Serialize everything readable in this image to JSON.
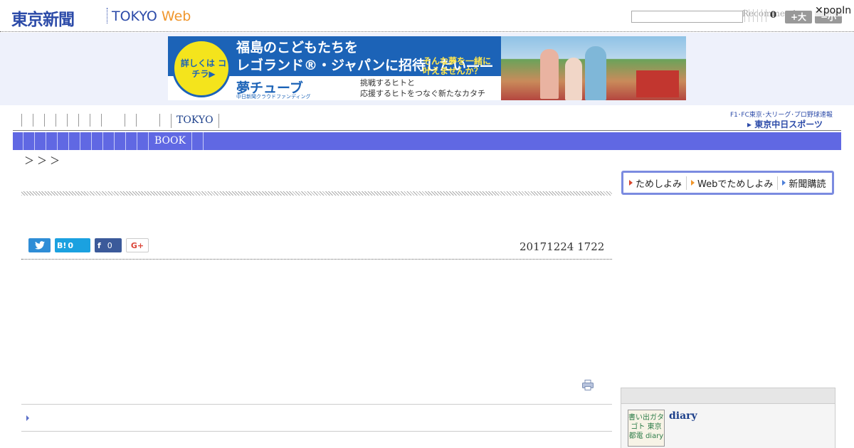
{
  "header": {
    "logo_jp": "東京新聞",
    "logo_tokyo": "TOKYO",
    "logo_web": "Web",
    "search_placeholder": "",
    "recommend": "Recommend",
    "count": "0",
    "font_big": "+大",
    "font_small": "−小",
    "popin": "✕popIn"
  },
  "ad": {
    "circle_text": "詳しくは コチラ▶",
    "headline_1": "福島のこどもたちを",
    "headline_2": "レゴランド®・ジャパンに招待したい——",
    "sub_1": "そんな夢を一緒に",
    "sub_2": "叶えませんか？",
    "brand": "夢チューブ",
    "brand_small": "中日新聞クラウドファンディング",
    "copy_1": "挑戦するヒトと",
    "copy_2": "応援するヒトをつなぐ新たなカタチ"
  },
  "nav": {
    "top_label": "TOKYO",
    "sub_label": "BOOK",
    "chunichi_link": "F1･FC東京･大リーグ･プロ野球速報",
    "chunichi_logo": "▸ 東京中日スポーツ"
  },
  "breadcrumb": "＞＞＞",
  "article": {
    "date": "20171224 1722"
  },
  "share": {
    "twitter_icon": "twitter-bird-icon",
    "hatena": "B!",
    "hatena_count": "0",
    "facebook": "f",
    "facebook_count": "0",
    "gplus": "G+"
  },
  "sidebar": {
    "subscribe_items": [
      "ためしよみ",
      "Webでためしよみ",
      "新聞購読"
    ],
    "diary_thumb": "書い出ガタゴト 東京都電 diary",
    "diary_title": "diary"
  },
  "colors": {
    "brand_blue": "#2b4aa8",
    "web_orange": "#f0962c",
    "subnav_bg": "#6068e3",
    "banner_bg": "#eef1fb"
  }
}
